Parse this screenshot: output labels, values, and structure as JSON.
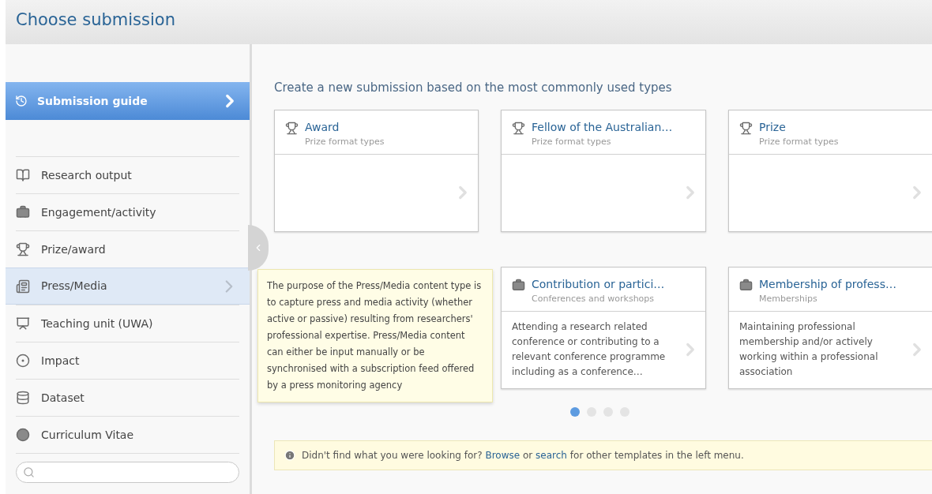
{
  "window": {
    "title": "Choose submission"
  },
  "sidebar": {
    "guide": {
      "label": "Submission guide"
    },
    "items": [
      {
        "label": "Research output",
        "kind": "book",
        "selected": false
      },
      {
        "label": "Engagement/activity",
        "kind": "briefcase",
        "selected": false
      },
      {
        "label": "Prize/award",
        "kind": "trophy",
        "selected": false
      },
      {
        "label": "Press/Media",
        "kind": "press",
        "selected": true
      },
      {
        "label": "Teaching unit (UWA)",
        "kind": "teaching",
        "selected": false
      },
      {
        "label": "Impact",
        "kind": "target",
        "selected": false
      },
      {
        "label": "Dataset",
        "kind": "database",
        "selected": false
      },
      {
        "label": "Curriculum Vitae",
        "kind": "cv",
        "selected": false
      }
    ]
  },
  "main": {
    "heading": "Create a new submission based on the most commonly used types",
    "card_rows": [
      [
        {
          "kind": "trophy",
          "title": "Award",
          "subtitle": "Prize format types"
        },
        {
          "kind": "trophy",
          "title": "Fellow of the Australian…",
          "subtitle": "Prize format types"
        },
        {
          "kind": "trophy",
          "title": "Prize",
          "subtitle": "Prize format types"
        }
      ],
      [
        {
          "kind": "briefcase",
          "title": "Contribution or partici…",
          "subtitle": "Conferences and workshops",
          "description": "Attending a research related conference or contributing to a relevant conference programme including as a conference…"
        },
        {
          "kind": "briefcase",
          "title": "Membership of profess…",
          "subtitle": "Memberships",
          "description": "Maintaining professional membership and/or actively working within a professional association"
        }
      ]
    ],
    "pages": [
      {
        "selected": true
      },
      {
        "selected": false
      },
      {
        "selected": false
      },
      {
        "selected": false
      }
    ],
    "tooltip": "The purpose of the Press/Media content type is to capture press and media activity (whether active or passive) resulting from researchers' professional expertise. Press/Media content can either be input manually or be synchronised with a subscription feed offered by a press monitoring agency",
    "notice": {
      "before": "Didn't find what you were looking for?",
      "link_1": "Browse",
      "middle": "or",
      "link_2": "search",
      "after": "for other templates in the left menu."
    }
  }
}
